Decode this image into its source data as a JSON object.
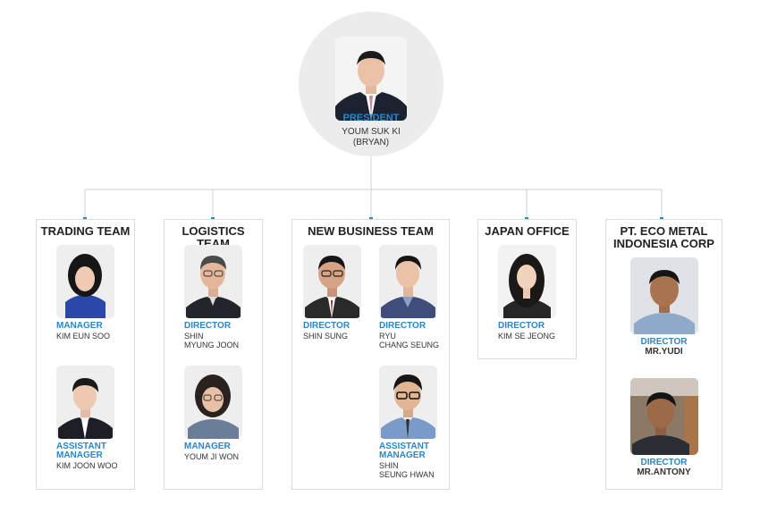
{
  "president": {
    "role": "PRESIDENT",
    "name_line1": "YOUM SUK KI",
    "name_line2": "(BRYAN)"
  },
  "teams": [
    {
      "title": "TRADING TEAM",
      "members": [
        {
          "role_line1": "MANAGER",
          "name_line1": "KIM EUN SOO"
        },
        {
          "role_line1": "ASSISTANT",
          "role_line2": "MANAGER",
          "name_line1": "KIM JOON WOO"
        }
      ]
    },
    {
      "title": "LOGISTICS TEAM",
      "members": [
        {
          "role_line1": "DIRECTOR",
          "name_line1": "SHIN",
          "name_line2": "MYUNG JOON"
        },
        {
          "role_line1": "MANAGER",
          "name_line1": "YOUM JI WON"
        }
      ]
    },
    {
      "title": "NEW BUSINESS TEAM",
      "members": [
        {
          "role_line1": "DIRECTOR",
          "name_line1": "SHIN SUNG"
        },
        {
          "role_line1": "DIRECTOR",
          "name_line1": "RYU",
          "name_line2": "CHANG SEUNG"
        },
        {
          "role_line1": "ASSISTANT",
          "role_line2": "MANAGER",
          "name_line1": "SHIN",
          "name_line2": "SEUNG  HWAN"
        }
      ]
    },
    {
      "title": "JAPAN OFFICE",
      "members": [
        {
          "role_line1": "DIRECTOR",
          "name_line1": "KIM SE JEONG"
        }
      ]
    },
    {
      "title_line1": "PT. ECO METAL",
      "title_line2": "INDONESIA CORP",
      "members": [
        {
          "role_line1": "DIRECTOR",
          "name_line1": "MR.YUDI"
        },
        {
          "role_line1": "DIRECTOR",
          "name_line1": "MR.ANTONY"
        }
      ]
    }
  ],
  "colors": {
    "accent": "#2b86c5",
    "connector": "#d0d0d0",
    "border": "#dcdcdc"
  }
}
